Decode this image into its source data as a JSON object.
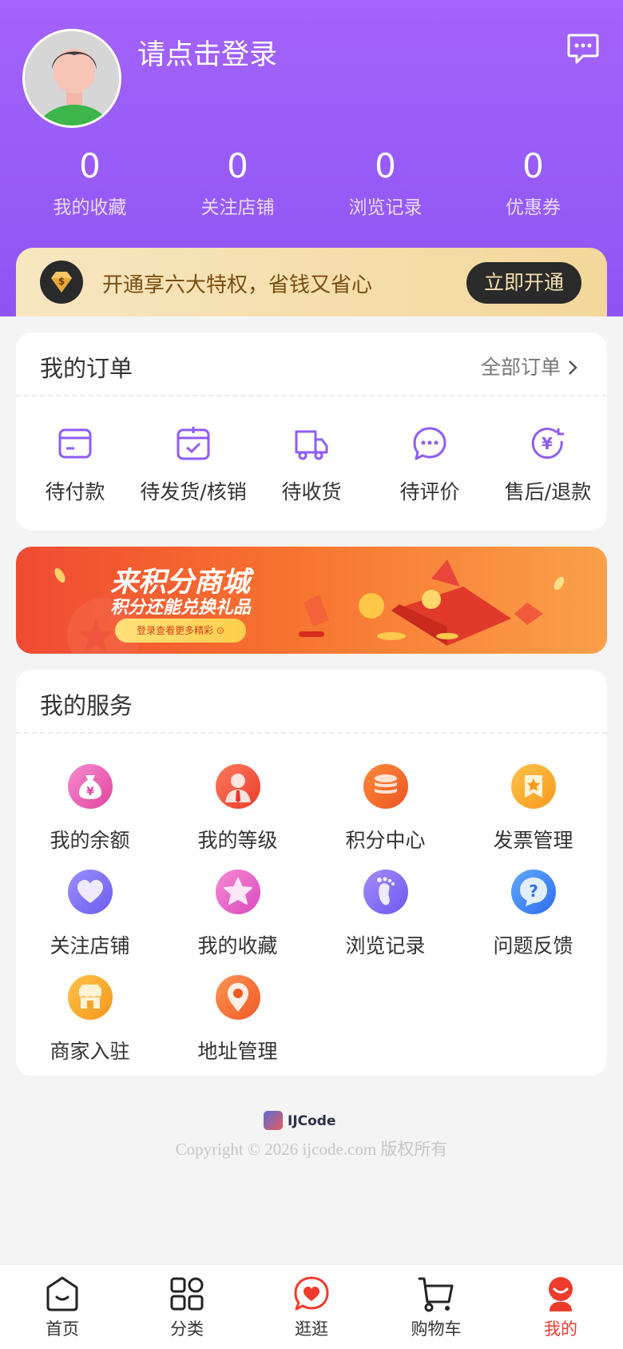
{
  "header": {
    "login_text": "请点击登录",
    "stats": [
      {
        "value": "0",
        "label": "我的收藏"
      },
      {
        "value": "0",
        "label": "关注店铺"
      },
      {
        "value": "0",
        "label": "浏览记录"
      },
      {
        "value": "0",
        "label": "优惠券"
      }
    ]
  },
  "vip": {
    "text": "开通享六大特权，省钱又省心",
    "button": "立即开通"
  },
  "orders": {
    "title": "我的订单",
    "all_label": "全部订单",
    "items": [
      {
        "label": "待付款",
        "icon": "wallet-icon"
      },
      {
        "label": "待发货/核销",
        "icon": "calendar-check-icon"
      },
      {
        "label": "待收货",
        "icon": "truck-icon"
      },
      {
        "label": "待评价",
        "icon": "chat-bubble-icon"
      },
      {
        "label": "售后/退款",
        "icon": "refund-icon"
      }
    ]
  },
  "banner": {
    "title": "来积分商城",
    "subtitle": "积分还能兑换礼品",
    "button": "登录查看更多精彩 ⊙"
  },
  "services": {
    "title": "我的服务",
    "items": [
      {
        "label": "我的余额",
        "icon": "money-bag-icon"
      },
      {
        "label": "我的等级",
        "icon": "user-level-icon"
      },
      {
        "label": "积分中心",
        "icon": "coins-icon"
      },
      {
        "label": "发票管理",
        "icon": "invoice-icon"
      },
      {
        "label": "关注店铺",
        "icon": "heart-icon"
      },
      {
        "label": "我的收藏",
        "icon": "star-icon"
      },
      {
        "label": "浏览记录",
        "icon": "footprint-icon"
      },
      {
        "label": "问题反馈",
        "icon": "question-icon"
      },
      {
        "label": "商家入驻",
        "icon": "store-icon"
      },
      {
        "label": "地址管理",
        "icon": "location-icon"
      }
    ]
  },
  "footer": {
    "brand": "IJCode",
    "copyright": "Copyright © 2026 ijcode.com 版权所有"
  },
  "tabbar": {
    "items": [
      {
        "label": "首页",
        "icon": "home-icon"
      },
      {
        "label": "分类",
        "icon": "category-icon"
      },
      {
        "label": "逛逛",
        "icon": "browse-heart-icon"
      },
      {
        "label": "购物车",
        "icon": "cart-icon"
      },
      {
        "label": "我的",
        "icon": "mine-icon",
        "active": true
      }
    ]
  },
  "colors": {
    "header": "#9b5cf9",
    "accent_purple": "#8e5cf5",
    "active_tab": "#ef3b2d",
    "vip_gold": "#f3d79b"
  }
}
